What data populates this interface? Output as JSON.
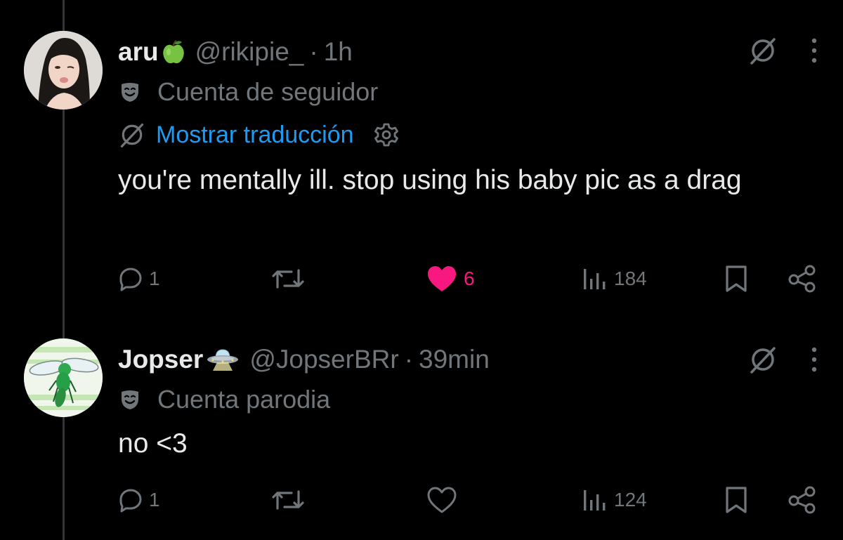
{
  "tweets": [
    {
      "display_name": "aru",
      "name_emoji": "🍏",
      "handle": "@rikipie_",
      "separator": "·",
      "time": "1h",
      "account_label": "Cuenta de seguidor",
      "translate_label": "Mostrar traducción",
      "text": "you're mentally ill. stop using his baby pic as a drag",
      "replies": "1",
      "retweets": "",
      "likes": "6",
      "liked": true,
      "views": "184",
      "icons": [
        "grok-icon",
        "more-icon",
        "reply-icon",
        "retweet-icon",
        "heart-icon",
        "views-icon",
        "bookmark-icon",
        "share-icon",
        "mask-icon",
        "gear-icon"
      ]
    },
    {
      "display_name": "Jopser",
      "name_emoji": "🛸",
      "handle": "@JopserBRr",
      "separator": "·",
      "time": "39min",
      "account_label": "Cuenta parodia",
      "text": "no <3",
      "replies": "1",
      "retweets": "",
      "likes": "",
      "liked": false,
      "views": "124",
      "icons": [
        "grok-icon",
        "more-icon",
        "reply-icon",
        "retweet-icon",
        "heart-icon",
        "views-icon",
        "bookmark-icon",
        "share-icon",
        "mask-icon"
      ]
    }
  ],
  "colors": {
    "background": "#000000",
    "primary_text": "#e7e9ea",
    "secondary_text": "#71767b",
    "link": "#1d9bf0",
    "like": "#f91880",
    "thread_line": "#333639"
  }
}
